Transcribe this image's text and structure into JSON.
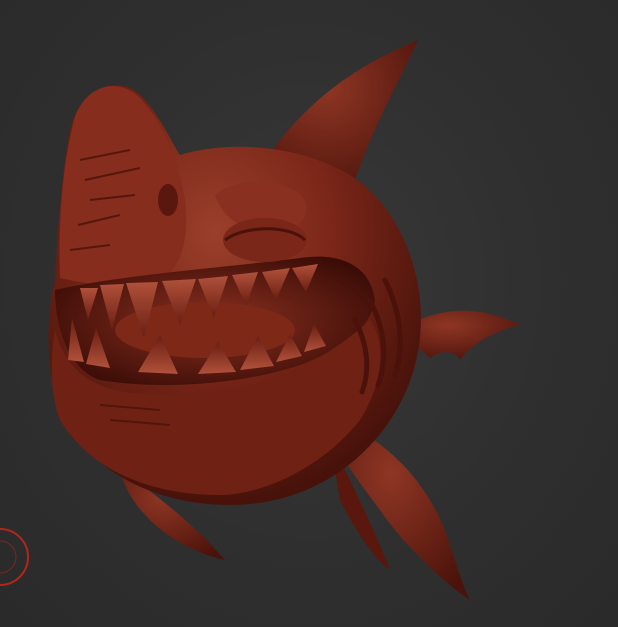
{
  "scene": {
    "background_color": "#2f2f2f",
    "subject": "sculpted-cartoon-shark",
    "material_color": "#7a2618",
    "highlight_color": "#a34a35",
    "shadow_color": "#3a0e08",
    "gizmo_color": "#b3261a",
    "gizmo_icon": "rotation-gizmo-icon"
  }
}
